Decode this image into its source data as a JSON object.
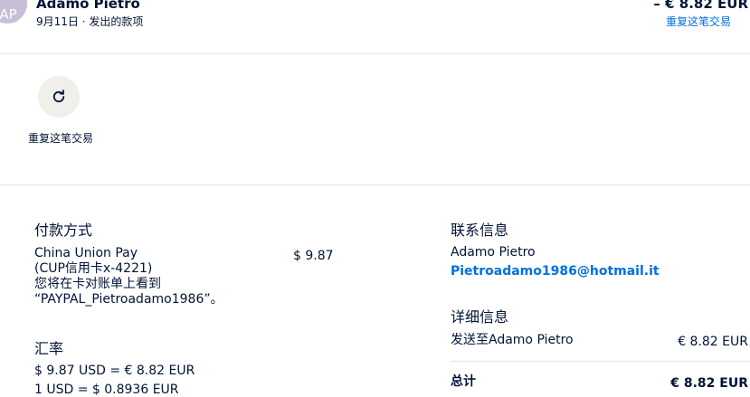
{
  "header": {
    "avatar_initials": "AP",
    "name": "Adamo Pietro",
    "subtitle": "9月11日 · 发出的款项",
    "amount": "– € 8.82 EUR",
    "repeat_link": "重复这笔交易"
  },
  "action": {
    "icon": "refresh-icon",
    "label": "重复这笔交易"
  },
  "payment": {
    "title": "付款方式",
    "method_lines": [
      "China Union Pay",
      "(CUP信用卡x-4221)",
      "您将在卡对账单上看到",
      "“PAYPAL_Pietroadamo1986”。"
    ],
    "amount": "$ 9.87",
    "exchange_title": "汇率",
    "exchange_lines": [
      "$ 9.87 USD = € 8.82 EUR",
      "1 USD = $ 0.8936 EUR"
    ]
  },
  "contact": {
    "title": "联系信息",
    "name": "Adamo Pietro",
    "email": "Pietroadamo1986@hotmail.it"
  },
  "details": {
    "title": "详细信息",
    "sent_to_label": "发送至Adamo Pietro",
    "sent_to_amount": "€ 8.82 EUR",
    "total_label": "总计",
    "total_amount": "€ 8.82 EUR"
  },
  "colors": {
    "text": "#001435",
    "link": "#0070e0",
    "avatar_bg": "#c6bfd6",
    "action_bg": "#f1efea",
    "divider": "#e4e6ea"
  }
}
